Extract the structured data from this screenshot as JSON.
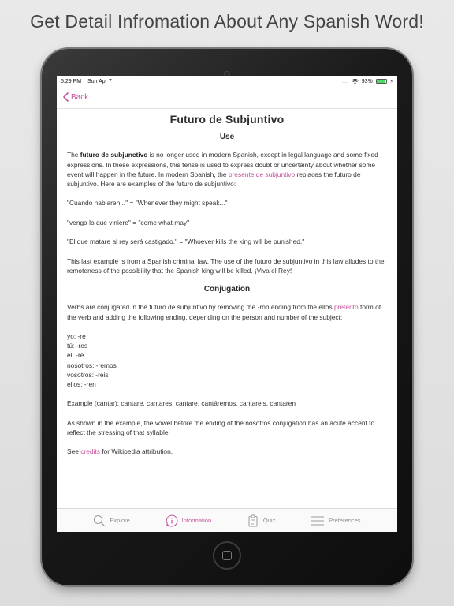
{
  "headline": "Get Detail Infromation About Any Spanish Word!",
  "status": {
    "time": "5:29 PM",
    "date": "Sun Apr 7",
    "signal": "....",
    "battery": "93%",
    "battery_level": 0.93
  },
  "nav": {
    "back_label": "Back"
  },
  "article": {
    "title": "Futuro de Subjuntivo",
    "use_heading": "Use",
    "p1_a": "The ",
    "p1_bold": "futuro de subjunctivo",
    "p1_b": " is no longer used in modern Spanish, except in legal language and some fixed expressions. In these expressions, this tense is used to express doubt or uncertainty about whether some event will happen in the future. In modern Spanish, the ",
    "p1_link": "presente de subjuntivo",
    "p1_c": " replaces the futuro de subjuntivo. Here are examples of the futuro de subjuntivo:",
    "ex1": "\"Cuando hablaren...\" = \"Whenever they might speak...\"",
    "ex2": "\"venga lo que viniere\" = \"come what may\"",
    "ex3": "\"El que matare al rey será castigado.\" = \"Whoever kills the king will be punished.\"",
    "p2": "This last example is from a Spanish criminal law. The use of the futuro de subjuntivo in this law alludes to the remoteness of the possibility that the Spanish king will be killed. ¡Viva el Rey!",
    "conj_heading": "Conjugation",
    "p3_a": "Verbs are conjugated in the futuro de subjuntivo by removing the -ron ending from the ellos ",
    "p3_link": "pretérito",
    "p3_b": " form of the verb and adding the following ending, depending on the person and number of the subject:",
    "endings": [
      "yo: -re",
      "tú: -res",
      "él: -re",
      "nosotros: -remos",
      "vosotros: -reis",
      "ellos: -ren"
    ],
    "example": "Example (cantar): cantare, cantares, cantare, cantáremos, cantareis, cantaren",
    "p4": "As shown in the example, the vowel before the ending of the nosotros conjugation has an acute accent to reflect the stressing of that syllable.",
    "see_a": "See ",
    "see_link": "credits",
    "see_b": " for Wikipedia attribution."
  },
  "tabs": [
    {
      "label": "Explore",
      "icon": "search-icon"
    },
    {
      "label": "Information",
      "icon": "info-icon"
    },
    {
      "label": "Quiz",
      "icon": "clipboard-icon"
    },
    {
      "label": "Preferences",
      "icon": "menu-lines-icon"
    }
  ],
  "colors": {
    "accent": "#c2549b",
    "tab_inactive": "#8e8e8e",
    "text": "#333333"
  }
}
